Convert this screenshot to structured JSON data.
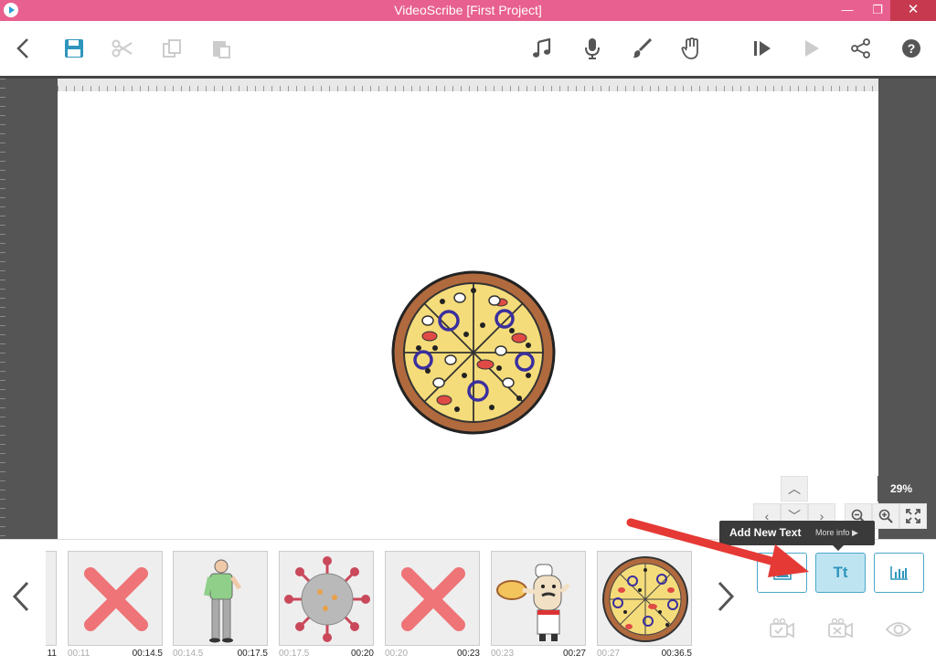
{
  "window": {
    "title": "VideoScribe [First Project]",
    "minimize_glyph": "—",
    "restore_glyph": "❐",
    "close_glyph": "✕"
  },
  "toolbar": {
    "left_icons": [
      "back-icon",
      "save-icon",
      "cut-icon",
      "copy-icon",
      "paste-icon"
    ],
    "right_icons": [
      "music-icon",
      "microphone-icon",
      "brush-icon",
      "hand-icon",
      "preview-from-start-icon",
      "play-icon",
      "share-icon",
      "help-icon"
    ]
  },
  "canvas": {
    "zoom": "29%",
    "nav_glyphs": {
      "up": "︿",
      "left": "‹",
      "down": "﹀",
      "right": "›"
    }
  },
  "tooltip": {
    "title": "Add New Text",
    "more": "More info ▶"
  },
  "timeline": {
    "prev_glyph": "❮",
    "next_glyph": "❯",
    "partial_time": "11",
    "items": [
      {
        "kind": "deleted",
        "start": "00:11",
        "end": "00:14.5"
      },
      {
        "kind": "man",
        "start": "00:14.5",
        "end": "00:17.5"
      },
      {
        "kind": "virus",
        "start": "00:17.5",
        "end": "00:20"
      },
      {
        "kind": "deleted",
        "start": "00:20",
        "end": "00:23"
      },
      {
        "kind": "chef",
        "start": "00:23",
        "end": "00:27"
      },
      {
        "kind": "pizza",
        "start": "00:27",
        "end": "00:36.5"
      }
    ]
  },
  "actions": {
    "text_label": "Tt"
  },
  "colors": {
    "titlebar": "#e8608f",
    "accent": "#2f95bd",
    "arrow": "#e53935"
  }
}
